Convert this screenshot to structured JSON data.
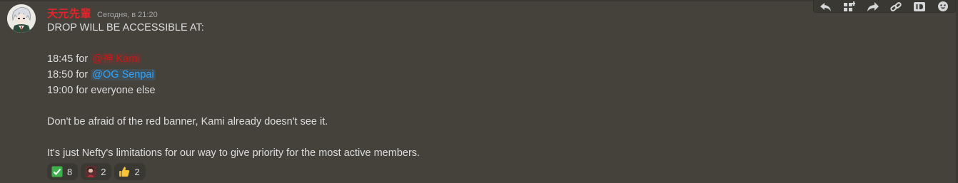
{
  "message": {
    "username": "天元先輩",
    "timestamp": "Сегодня, в 21:20",
    "lines": {
      "l1": "DROP WILL BE ACCESSIBLE AT:",
      "l2_prefix": "18:45 for ",
      "l2_mention": "@神 Kami",
      "l3_prefix": "18:50 for ",
      "l3_mention": "@OG Senpai",
      "l4": "19:00 for everyone else",
      "l5": "Don't be afraid of the red banner, Kami already doesn't see it.",
      "l6": "It's just Nefty's limitations for our way to give priority for the most active members."
    },
    "reactions": [
      {
        "icon": "check-mark-icon",
        "count": "8"
      },
      {
        "icon": "custom-emoji-icon",
        "count": "2"
      },
      {
        "icon": "thumbs-up-icon",
        "count": "2"
      }
    ]
  },
  "toolbar": {
    "icons": [
      "reply-icon",
      "app-icon",
      "forward-icon",
      "link-icon",
      "id-icon",
      "add-reaction-icon"
    ]
  },
  "colors": {
    "background": "#45423b",
    "username": "#e0262a",
    "mention_red": "#c41a1a",
    "mention_blue": "#31a6ff"
  }
}
